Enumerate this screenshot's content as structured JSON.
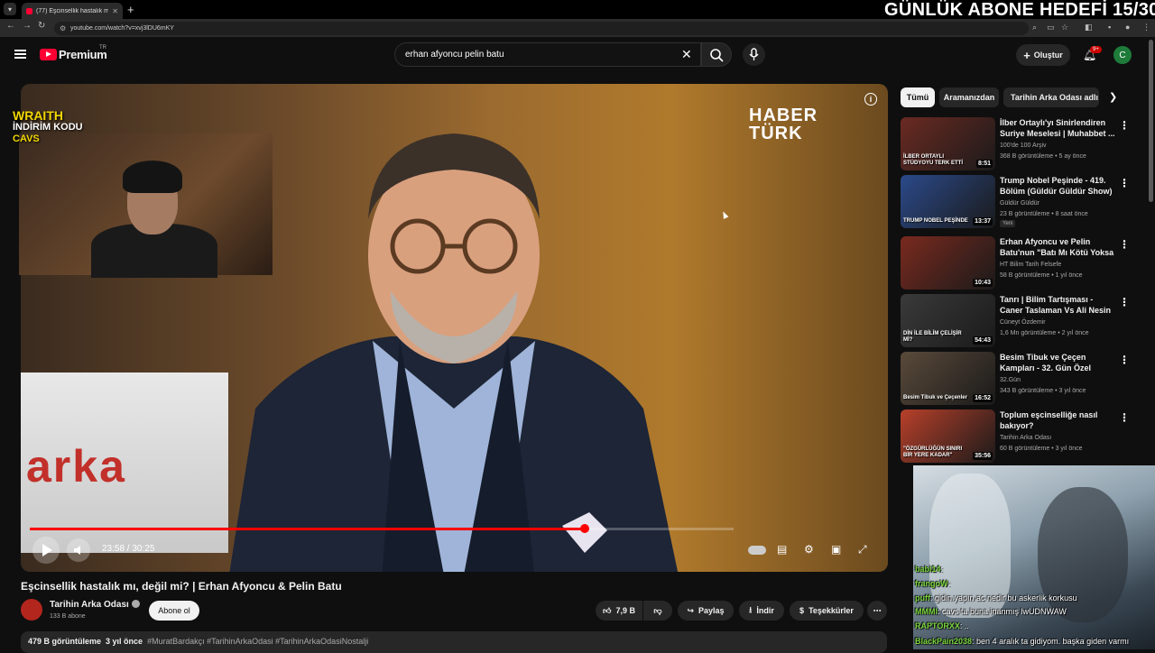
{
  "browser": {
    "tab_title": "(77) Eşcinsellik hastalık mı...",
    "url": "youtube.com/watch?v=xvj3lDU6mKY"
  },
  "stream_overlay": {
    "goal_text": "GÜNLÜK ABONE HEDEFİ 15/30",
    "sponsor_brand": "WRAITH",
    "sponsor_line": "İNDİRİM KODU",
    "sponsor_code": "CAVS"
  },
  "header": {
    "logo_text": "Premium",
    "logo_region": "TR",
    "search_value": "erhan afyoncu pelin batu",
    "create_label": "Oluştur",
    "notif_count": "9+",
    "avatar_letter": "C"
  },
  "player": {
    "channel_bug": [
      "HABER",
      "TÜRK"
    ],
    "sign_text": "arka",
    "time": "23:58 / 30:25",
    "progress": 0.788,
    "buffered": 0.82
  },
  "video": {
    "title": "Eşcinsellik hastalık mı, değil mi? | Erhan Afyoncu & Pelin Batu",
    "channel": "Tarihin Arka Odası",
    "subs": "133 B abone",
    "subscribe_label": "Abone ol",
    "likes": "7,9 B",
    "share_label": "Paylaş",
    "download_label": "İndir",
    "thanks_label": "Teşekkürler",
    "views": "479 B görüntüleme",
    "age": "3 yıl önce",
    "hashtags": "#MuratBardakçı #TarihinArkaOdasi #TarihinArkaOdasiNostalji"
  },
  "chips": [
    "Tümü",
    "Aramanızdan",
    "Tarihin Arka Odası adlı y"
  ],
  "recommendations": [
    {
      "title": "İlber Ortaylı'yı Sinirlendiren Suriye Meselesi | Muhabbet ...",
      "channel": "100'de 100 Arşiv",
      "meta": "368 B görüntüleme • 5 ay önce",
      "duration": "8:51",
      "thumb_caption": "İLBER ORTAYLI STÜDYOYU TERK ETTİ",
      "color": "#6b2a22"
    },
    {
      "title": "Trump Nobel Peşinde - 419. Bölüm (Güldür Güldür Show)",
      "channel": "Güldür Güldür",
      "meta": "23 B görüntüleme • 8 saat önce",
      "badge": "Yeni",
      "duration": "13:37",
      "thumb_caption": "TRUMP NOBEL PEŞİNDE",
      "color": "#2b4a8a"
    },
    {
      "title": "Erhan Afyoncu ve Pelin Batu'nun \"Batı Mı Kötü Yoksa Biz Mi ...",
      "channel": "HT Bilim Tarih Felsefe",
      "meta": "58 B görüntüleme • 1 yıl önce",
      "duration": "10:43",
      "thumb_caption": "",
      "color": "#7a2a1e"
    },
    {
      "title": "Tanrı | Bilim Tartışması - Caner Taslaman Vs Ali Nesin",
      "channel": "Cüneyt Özdemir",
      "meta": "1,6 Mn görüntüleme • 2 yıl önce",
      "duration": "54:43",
      "thumb_caption": "DİN İLE BİLİM ÇELİŞİR Mİ?",
      "color": "#3a3a3a"
    },
    {
      "title": "Besim Tibuk ve Çeçen Kampları - 32. Gün Özel Arşivi",
      "channel": "32.Gün",
      "meta": "343 B görüntüleme • 3 yıl önce",
      "duration": "16:52",
      "thumb_caption": "Besim Tibuk ve Çeçenler",
      "color": "#5a4a3a"
    },
    {
      "title": "Toplum eşcinselliğe nasıl bakıyor?",
      "channel": "Tarihin Arka Odası",
      "meta": "60 B görüntüleme • 3 yıl önce",
      "duration": "35:56",
      "thumb_caption": "\"ÖZGÜRLÜĞÜN SINIRI BİR YERE KADAR\"",
      "color": "#b8402a"
    }
  ],
  "chat": [
    {
      "user": "babi14",
      "msg": ":"
    },
    {
      "user": "frangoW",
      "msg": ":"
    },
    {
      "user": "puff",
      "msg": ": gidin yapın ac nedir bu askerlik korkusu"
    },
    {
      "user": "MMMI",
      "msg": ": cavs ta buna inanmış lwUDNWAW"
    },
    {
      "user": "RAPTORXX",
      "msg": ": .."
    },
    {
      "user": "BlackPain2038",
      "msg": ": ben 4 aralık ta gidiyom. başka giden varmı"
    }
  ],
  "colors": {
    "accent": "#ff0033",
    "bg": "#0f0f0f",
    "surface": "#272727"
  }
}
